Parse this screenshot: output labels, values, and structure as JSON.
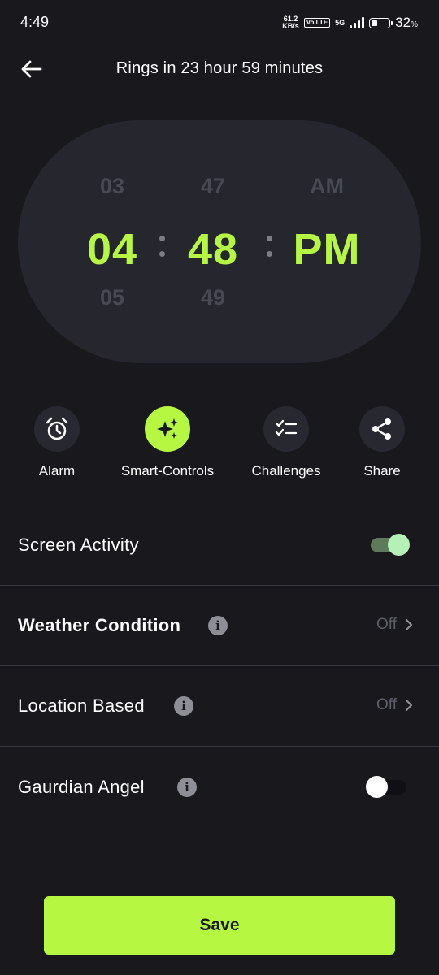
{
  "status_bar": {
    "time": "4:49",
    "net_speed_value": "61.2",
    "net_speed_unit": "KB/s",
    "volte": "Vo LTE",
    "network": "5G",
    "battery_percent": "32",
    "battery_unit": "%"
  },
  "header": {
    "title": "Rings in 23 hour 59 minutes",
    "back_icon": "arrow-left-icon"
  },
  "time_picker": {
    "hour_prev": "03",
    "hour": "04",
    "hour_next": "05",
    "minute_prev": "47",
    "minute": "48",
    "minute_next": "49",
    "period_prev": "AM",
    "period": "PM",
    "accent_color": "#b6f742"
  },
  "tabs": [
    {
      "label": "Alarm",
      "icon": "alarm-clock-icon",
      "active": false
    },
    {
      "label": "Smart-Controls",
      "icon": "sparkles-icon",
      "active": true
    },
    {
      "label": "Challenges",
      "icon": "checklist-icon",
      "active": false
    },
    {
      "label": "Share",
      "icon": "share-icon",
      "active": false
    }
  ],
  "settings": {
    "screen_activity": {
      "label": "Screen Activity",
      "enabled": true
    },
    "weather_condition": {
      "label": "Weather Condition",
      "value": "Off",
      "info_icon": "info-icon"
    },
    "location_based": {
      "label": "Location Based",
      "value": "Off",
      "info_icon": "info-icon"
    },
    "guardian_angel": {
      "label": "Gaurdian Angel",
      "enabled": false,
      "info_icon": "info-icon"
    }
  },
  "save_button": {
    "label": "Save"
  }
}
